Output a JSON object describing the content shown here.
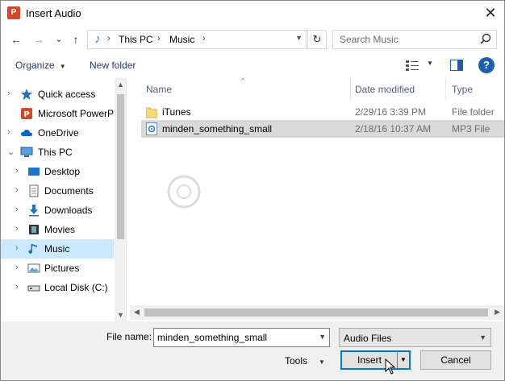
{
  "window": {
    "title": "Insert Audio",
    "close_glyph": "✕"
  },
  "nav": {
    "back": "←",
    "forward": "→",
    "recent": "⌄",
    "up": "↑",
    "address": [
      "This PC",
      "Music"
    ],
    "refresh": "↻",
    "search_placeholder": "Search Music"
  },
  "toolbar": {
    "organize": "Organize",
    "new_folder": "New folder",
    "help": "?"
  },
  "navpane": {
    "items": [
      {
        "label": "Quick access",
        "icon": "star-icon",
        "expander": "›"
      },
      {
        "label": "Microsoft PowerP",
        "icon": "powerpoint-icon",
        "expander": ""
      },
      {
        "label": "OneDrive",
        "icon": "cloud-icon",
        "expander": "›"
      },
      {
        "label": "This PC",
        "icon": "computer-icon",
        "expander": "⌄"
      },
      {
        "label": "Desktop",
        "icon": "desktop-icon",
        "expander": "›"
      },
      {
        "label": "Documents",
        "icon": "documents-icon",
        "expander": "›"
      },
      {
        "label": "Downloads",
        "icon": "downloads-icon",
        "expander": "›"
      },
      {
        "label": "Movies",
        "icon": "movies-icon",
        "expander": "›"
      },
      {
        "label": "Music",
        "icon": "music-icon",
        "expander": "›"
      },
      {
        "label": "Pictures",
        "icon": "pictures-icon",
        "expander": "›"
      },
      {
        "label": "Local Disk (C:)",
        "icon": "disk-icon",
        "expander": "›"
      }
    ],
    "selected": "Music"
  },
  "filelist": {
    "columns": [
      "Name",
      "Date modified",
      "Type"
    ],
    "rows": [
      {
        "name": "iTunes",
        "date": "2/29/16 3:39 PM",
        "type": "File folder",
        "icon": "folder-icon"
      },
      {
        "name": "minden_something_small",
        "date": "2/18/16 10:37 AM",
        "type": "MP3 File",
        "icon": "audio-file-icon"
      }
    ],
    "selected_row": 1
  },
  "bottom": {
    "file_name_label": "File name:",
    "file_name_value": "minden_something_small",
    "file_type": "Audio Files",
    "tools": "Tools",
    "insert": "Insert",
    "cancel": "Cancel"
  },
  "colors": {
    "accent": "#0078d7",
    "selection": "#cce8ff",
    "row_selected": "#d9d9d9"
  }
}
